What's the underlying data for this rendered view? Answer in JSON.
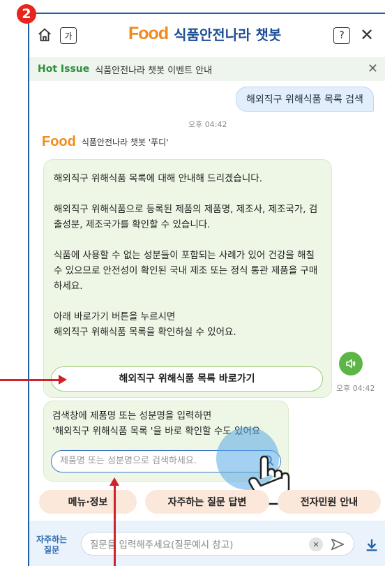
{
  "step_number": "2",
  "header": {
    "font_size_label": "가",
    "brand_logo": "Food",
    "title": "식품안전나라 챗봇",
    "help_label": "?"
  },
  "hot_issue": {
    "label": "Hot Issue",
    "text": "식품안전나라 챗봇 이벤트 안내"
  },
  "chat": {
    "user_message": "해외직구 위해식품 목록 검색",
    "user_time": "오후 04:42",
    "bot_name": "식품안전나라 챗봇 '푸디'",
    "bot_paragraphs": [
      "해외직구 위해식품 목록에 대해 안내해 드리겠습니다.",
      "해외직구 위해식품으로 등록된 제품의 제품명, 제조사, 제조국가, 검출성분, 제조국가를 확인할 수 있습니다.",
      "식품에 사용할 수 없는 성분들이 포함되는 사례가 있어 건강을 해칠 수 있으므로 안전성이 확인된 국내 제조 또는 정식 통관 제품을 구매하세요.",
      "아래 바로가기 버튼을 누르시면\n해외직구 위해식품 목록을 확인하실 수 있어요."
    ],
    "link_button": "해외직구 위해식품 목록 바로가기",
    "bot_time": "오후 04:42",
    "search_text_1": "검색창에 제품명 또는 성분명을 입력하면",
    "search_text_2": "'해외직구 위해식품 목록 '을 바로 확인할 수도 있어요",
    "search_placeholder": "제품명 또는 성분명으로 검색하세요."
  },
  "quick_menu": [
    "메뉴·정보",
    "자주하는 질문 답변",
    "전자민원 안내"
  ],
  "input_bar": {
    "faq_label_1": "자주하는",
    "faq_label_2": "질문",
    "placeholder": "질문을 입력해주세요(질문예시 참고)"
  },
  "colors": {
    "brand_orange": "#f28a1a",
    "brand_green": "#7ac142",
    "title_blue": "#1e4f96",
    "annotation_red": "#d0222a"
  }
}
